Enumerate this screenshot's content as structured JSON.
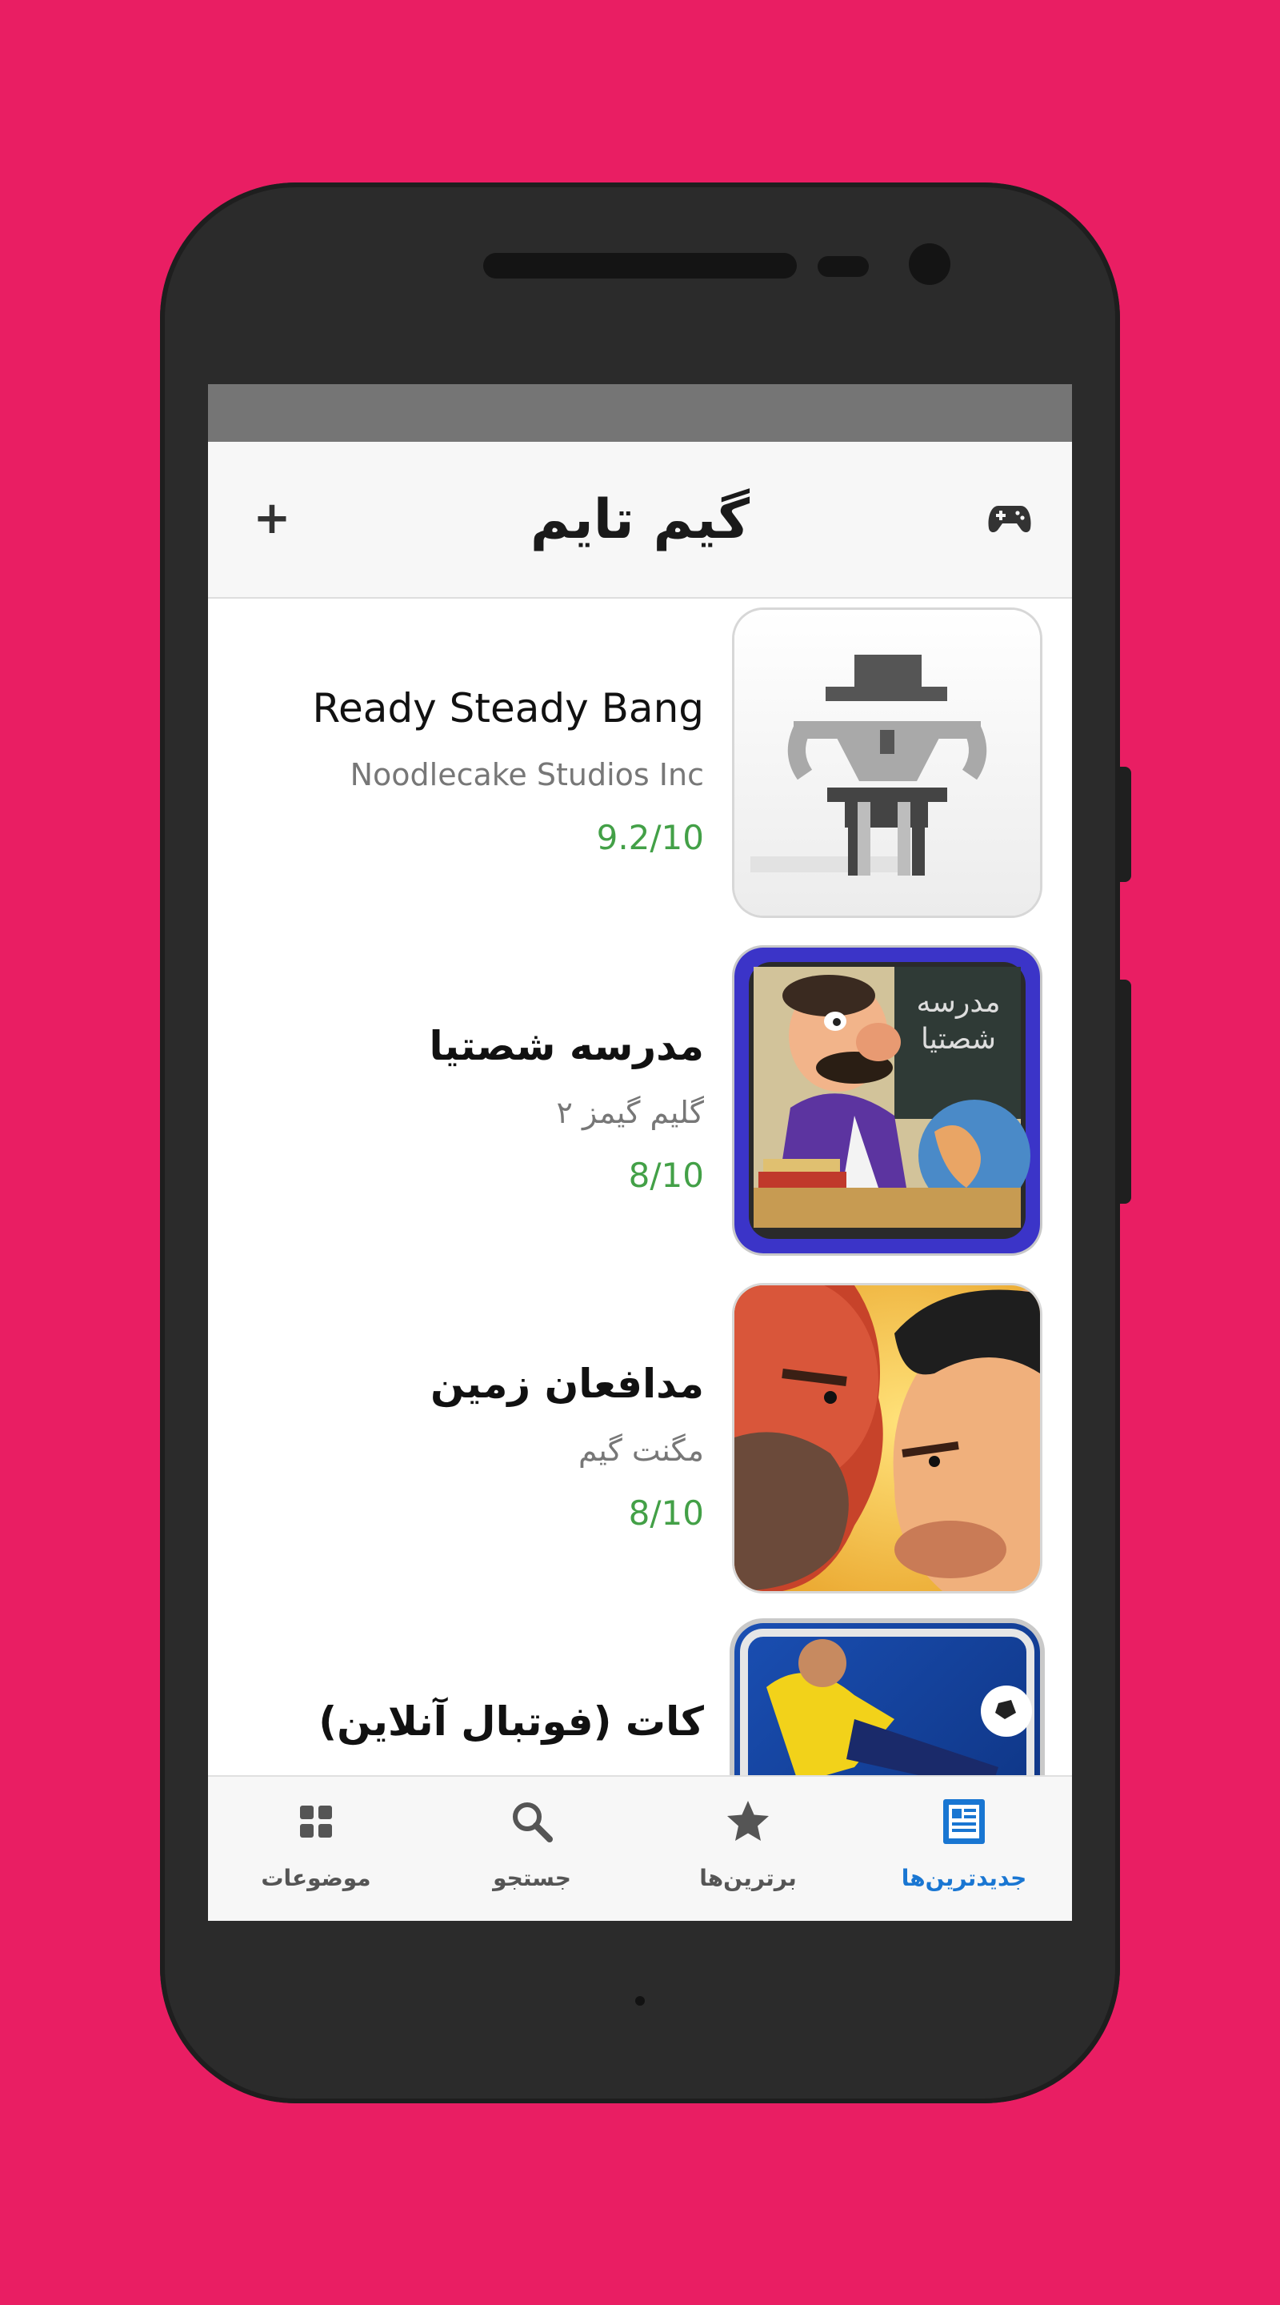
{
  "app": {
    "title": "گیم تایم",
    "add_label": "+",
    "header_icon": "gamepad-icon"
  },
  "games": [
    {
      "title": "Ready Steady Bang",
      "developer": "Noodlecake Studios Inc",
      "rating": "9.2/10",
      "thumb": "cowboy-art"
    },
    {
      "title": "مدرسه شصتیا",
      "developer": "گلیم گیمز ۲",
      "rating": "8/10",
      "thumb": "teacher-art"
    },
    {
      "title": "مدافعان زمین",
      "developer": "مگنت گیم",
      "rating": "8/10",
      "thumb": "faces-art"
    },
    {
      "title": "کات (فوتبال آنلاین)",
      "developer": "",
      "rating": "",
      "thumb": "football-art"
    }
  ],
  "nav": {
    "tabs": [
      {
        "label": "موضوعات",
        "icon": "grid-icon"
      },
      {
        "label": "جستجو",
        "icon": "search-icon"
      },
      {
        "label": "برترین‌ها",
        "icon": "star-icon"
      },
      {
        "label": "جدیدترین‌ها",
        "icon": "newspaper-icon",
        "active": true
      }
    ],
    "active_color": "#1976D2"
  },
  "colors": {
    "background": "#E91E63",
    "rating": "#43a047",
    "phone": "#2b2b2b"
  }
}
